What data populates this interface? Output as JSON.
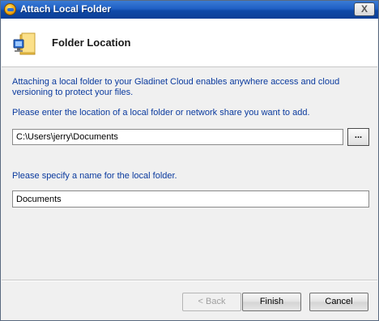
{
  "window": {
    "title": "Attach Local Folder",
    "close_glyph": "X",
    "icon": "app-globe-icon"
  },
  "header": {
    "title": "Folder Location",
    "icon": "folder-computer-icon"
  },
  "content": {
    "intro": "Attaching a local folder to your Gladinet Cloud enables anywhere access and cloud versioning to protect your files.",
    "location_prompt": "Please enter the location of a local folder or network share you want to add.",
    "location_value": "C:\\Users\\jerry\\Documents",
    "browse_label": "...",
    "name_prompt": "Please specify a name for the local folder.",
    "name_value": "Documents"
  },
  "footer": {
    "back_label": "< Back",
    "finish_label": "Finish",
    "cancel_label": "Cancel"
  },
  "colors": {
    "titlebar": "#1f5fc4",
    "prompt_text": "#0a3a9e",
    "dialog_bg": "#f0f0f0"
  }
}
